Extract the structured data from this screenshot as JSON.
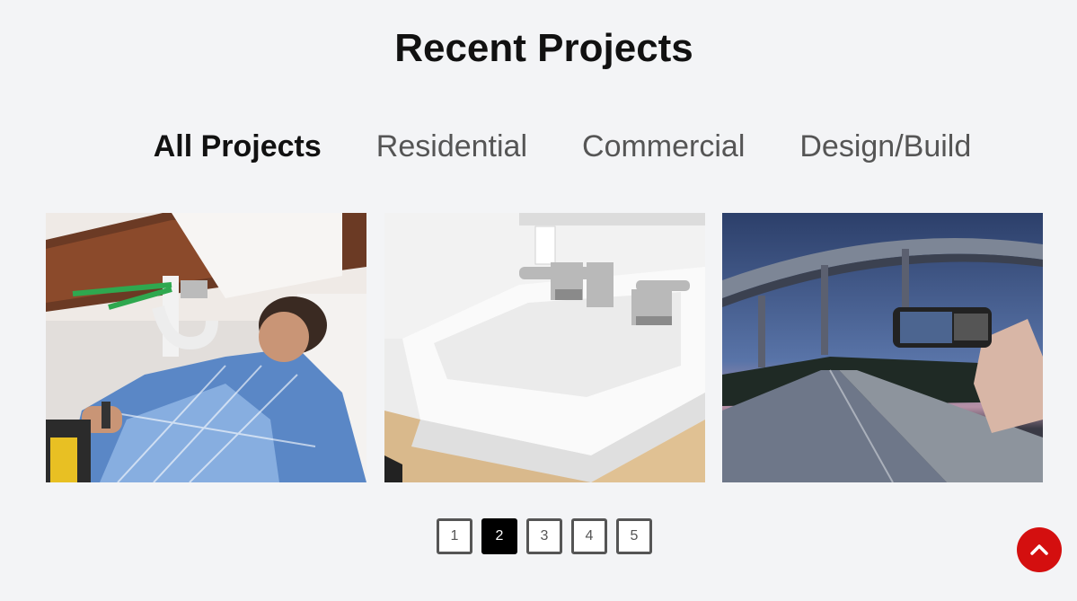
{
  "section": {
    "title": "Recent Projects"
  },
  "filters": [
    {
      "label": "All Projects",
      "active": true
    },
    {
      "label": "Residential",
      "active": false
    },
    {
      "label": "Commercial",
      "active": false
    },
    {
      "label": "Design/Build",
      "active": false
    }
  ],
  "projects": [
    {
      "image": "plumber-under-sink"
    },
    {
      "image": "bathroom-sink-faucet"
    },
    {
      "image": "phone-photo-overpass-road"
    }
  ],
  "pagination": {
    "pages": [
      "1",
      "2",
      "3",
      "4",
      "5"
    ],
    "current": "2"
  },
  "colors": {
    "background": "#f3f4f6",
    "accent": "#d40f0f",
    "active_page": "#000000",
    "text_dark": "#111111",
    "text_muted": "#555555"
  },
  "back_to_top": {
    "icon": "chevron-up-icon"
  }
}
